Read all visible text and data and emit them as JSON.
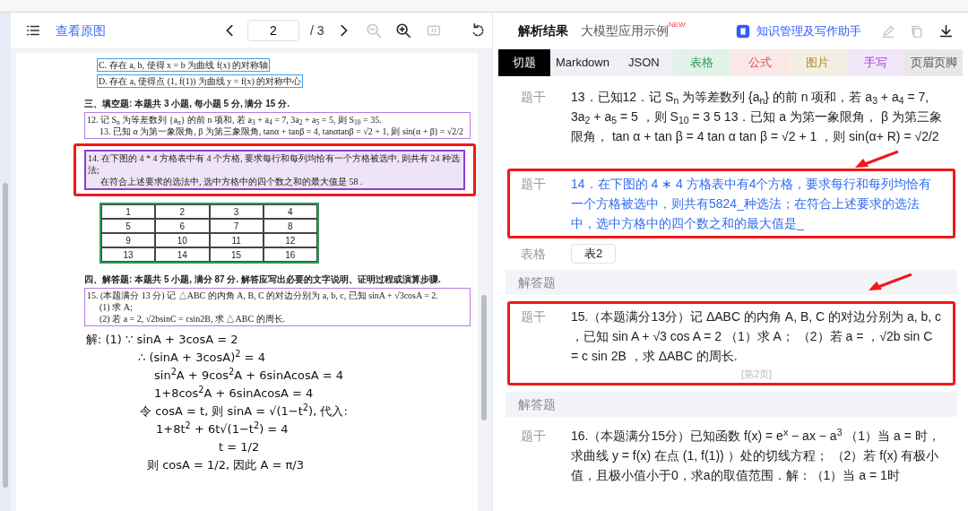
{
  "viewer_toolbar": {
    "view_original": "查看原图",
    "page": "2",
    "page_total": "/ 3"
  },
  "document": [
    {
      "kind": "option",
      "text": "C. 存在 a, b, 使得 x = b 为曲线 f(x) 的对称轴"
    },
    {
      "kind": "option",
      "text": "D. 存在 a, 使得点 (1, f(1)) 为曲线 y = f(x) 的对称中心"
    },
    {
      "kind": "heading",
      "text": "三、填空题: 本题共 3 小题, 每小题 5 分, 满分 15 分."
    },
    {
      "kind": "question",
      "annotated": false,
      "highlighted": false,
      "lines": [
        "12. 记 S$_{n}$ 为等差数列 {a$_{n}$} 的前 n 项和, 若 a$_{3}$ + a$_{4}$ = 7, 3a$_{2}$ + a$_{5}$ = 5, 则 S$_{10}$ = 35.",
        "13. 已知 α 为第一象限角, β 为第三象限角, tanα + tanβ = 4, tanαtanβ = √2 + 1, 则 sin(α + β) = √2/2"
      ]
    },
    {
      "kind": "question",
      "annotated": true,
      "highlighted": true,
      "lines": [
        "14. 在下图的 4 * 4 方格表中有 4 个方格, 要求每行和每列均恰有一个方格被选中, 则共有 24 种选法;",
        "在符合上述要求的选法中, 选中方格中的四个数之和的最大值是 58 ."
      ]
    },
    {
      "kind": "grid",
      "rows": [
        [
          "1",
          "2",
          "3",
          "4"
        ],
        [
          "5",
          "6",
          "7",
          "8"
        ],
        [
          "9",
          "10",
          "11",
          "12"
        ],
        [
          "13",
          "14",
          "15",
          "16"
        ]
      ]
    },
    {
      "kind": "heading",
      "text": "四、解答题: 本题共 5 小题, 满分 87 分. 解答应写出必要的文字说明、证明过程或演算步骤."
    },
    {
      "kind": "question",
      "annotated": false,
      "highlighted": false,
      "lines": [
        "15. (本题满分 13 分) 记 △ABC 的内角 A, B, C 的对边分别为 a, b, c, 已知 sinA + √3cosA = 2.",
        "(1) 求 A;",
        "(2) 若 a = 2, √2bsinC = csin2B, 求 △ABC 的周长."
      ]
    },
    {
      "kind": "handwriting",
      "lines": [
        "解: (1) ∵ sinA + 3cosA = 2",
        "∴ (sinA + 3cosA)$^{2}$ = 4",
        "sin$^{2}$A + 9cos$^{2}$A + 6sinAcosA = 4",
        "1+8cos$^{2}$A + 6sinAcosA = 4",
        "令 cosA = t, 则 sinA = √(1−t$^{2}$), 代入:",
        "1+8t$^{2}$ + 6t√(1−t$^{2}$) = 4",
        "t = 1/2",
        "则 cosA = 1/2, 因此 A = π/3"
      ]
    }
  ],
  "result_header": {
    "title": "解析结果",
    "examples": "大模型应用示例",
    "examples_badge": "NEW",
    "assistant": "知识管理及写作助手"
  },
  "tabs": [
    {
      "label": "切题",
      "selected": true
    },
    {
      "label": "Markdown",
      "selected": false
    },
    {
      "label": "JSON",
      "selected": false
    },
    {
      "label": "表格",
      "color": "#2d9a5a",
      "selected": false
    },
    {
      "label": "公式",
      "color": "#d9534f",
      "selected": false
    },
    {
      "label": "图片",
      "color": "#b0892a",
      "selected": false
    },
    {
      "label": "手写",
      "color": "#9a45d4",
      "selected": false
    },
    {
      "label": "页眉页脚",
      "color": "#555555",
      "selected": false
    }
  ],
  "results": [
    {
      "kind": "item",
      "label": "题干",
      "highlighted": false,
      "annotated": false,
      "arrow": true,
      "text": "13．已知12．记 S$_{n}$ 为等差数列 {a$_{n}$} 的前 n 项和，若 a$_{3}$ + a$_{4}$ = 7, 3a$_{2}$ + a$_{5}$ = 5 ，则 S$_{10}$ = 3 5 13．已知 a 为第一象限角， β 为第三象限角， tan α + tan β = 4 tan α tan β = √2 + 1 ，则 sin(α+ R) = √2/2"
    },
    {
      "kind": "item",
      "label": "题干",
      "highlighted": true,
      "annotated": true,
      "arrow": false,
      "text": "14．在下图的 4 ∗ 4 方格表中有4个方格，要求每行和每列均恰有一个方格被选中，则共有5824_种选法；在符合上述要求的选法中，选中方格中的四个数之和的最大值是_"
    },
    {
      "kind": "table_ref",
      "label": "表格",
      "button": "表2"
    },
    {
      "kind": "section",
      "label": "解答题",
      "arrow": true
    },
    {
      "kind": "item",
      "label": "题干",
      "highlighted": false,
      "annotated": true,
      "arrow": false,
      "text": "15.（本题满分13分）记 ΔABC 的内角 A, B, C 的对边分别为 a, b, c ，已知 sin A + √3 cos A = 2 （1）求 A； （2）若 a = ，√2b sin C = c sin 2B ，求 ΔABC 的周长.",
      "page_marker": "[第2页]"
    },
    {
      "kind": "section",
      "label": "解答题",
      "arrow": false
    },
    {
      "kind": "item",
      "label": "题干",
      "highlighted": false,
      "annotated": false,
      "arrow": false,
      "text": "16.（本题满分15分）已知函数 f(x) = e$^{x}$ − ax − a$^{3}$ （1）当 a = 时，求曲线 y = f(x) 在点 (1, f(1)) ）处的切线方程； （2）若 f(x) 有极小值，且极小值小于0，求a的取值范围．解：（1）当 a = 1时"
    }
  ]
}
